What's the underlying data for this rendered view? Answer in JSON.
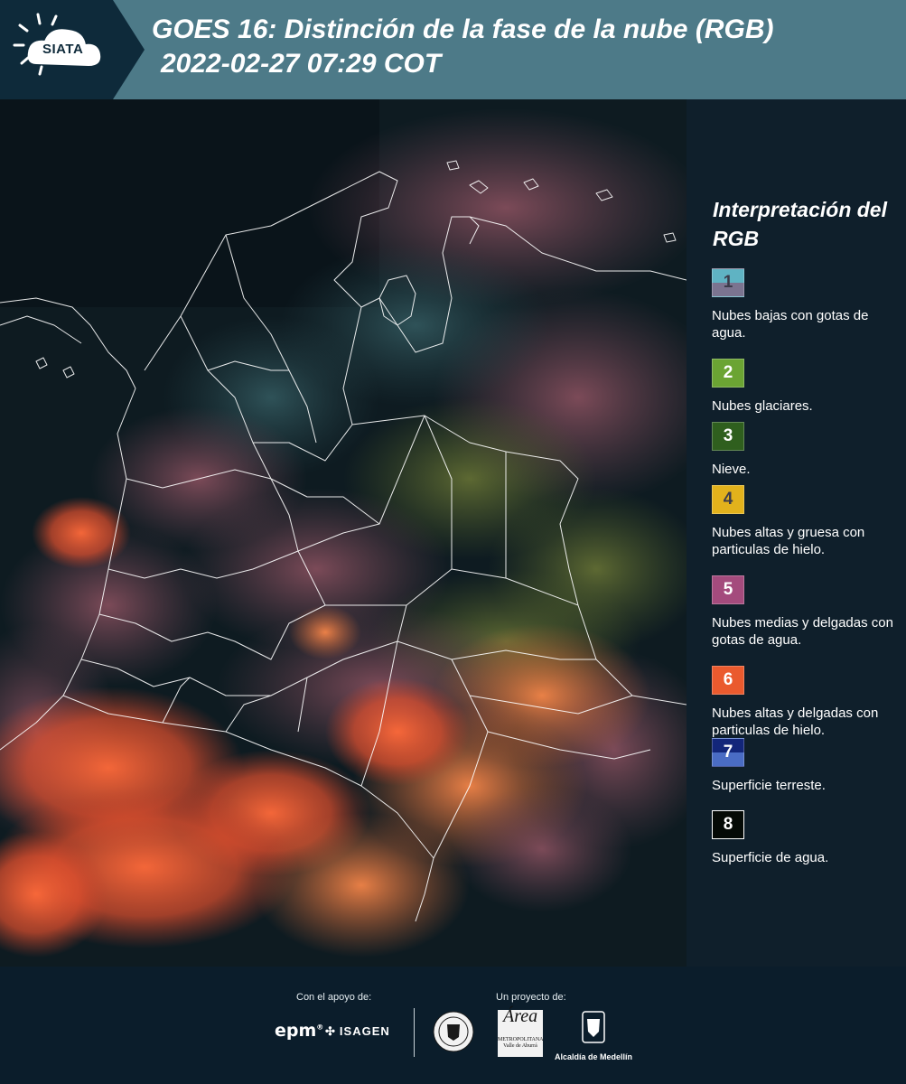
{
  "header": {
    "logo_text": "SIATA",
    "title_line1": "GOES 16: Distinción de la fase de la nube (RGB)",
    "title_line2": "2022-02-27 07:29 COT"
  },
  "map": {
    "icon": "satellite-rgb-map",
    "colors": {
      "background": "#0d1a20",
      "boundary": "#ffffff"
    }
  },
  "legend": {
    "title": "Interpretación del RGB",
    "items": [
      {
        "num": "1",
        "label": "Nubes bajas con gotas de agua.",
        "color_top": "#5fb3c3",
        "color_bottom": "#7b7490"
      },
      {
        "num": "2",
        "label": "Nubes glaciares.",
        "color": "#6ba433"
      },
      {
        "num": "3",
        "label": "Nieve.",
        "color": "#2f5f1e"
      },
      {
        "num": "4",
        "label": "Nubes altas y gruesa con particulas de hielo.",
        "color": "#e2b21c"
      },
      {
        "num": "5",
        "label": "Nubes medias y delgadas con gotas de agua.",
        "color": "#a44b7d"
      },
      {
        "num": "6",
        "label": "Nubes altas y delgadas con particulas de hielo.",
        "color": "#ea5a2e"
      },
      {
        "num": "7",
        "label": "Superficie terreste.",
        "color_top": "#13267a",
        "color_bottom": "#4a6cc4"
      },
      {
        "num": "8",
        "label": "Superficie de agua.",
        "color": "#050a06"
      }
    ]
  },
  "footer": {
    "support_caption": "Con el apoyo de:",
    "project_caption": "Un proyecto de:",
    "logos": {
      "epm": "epm",
      "isagen": "ISAGEN",
      "area_script": "Área",
      "area_name": "METROPOLITANA",
      "area_sub": "Valle de Aburrá",
      "alcaldia": "Alcaldía de Medellín"
    }
  }
}
